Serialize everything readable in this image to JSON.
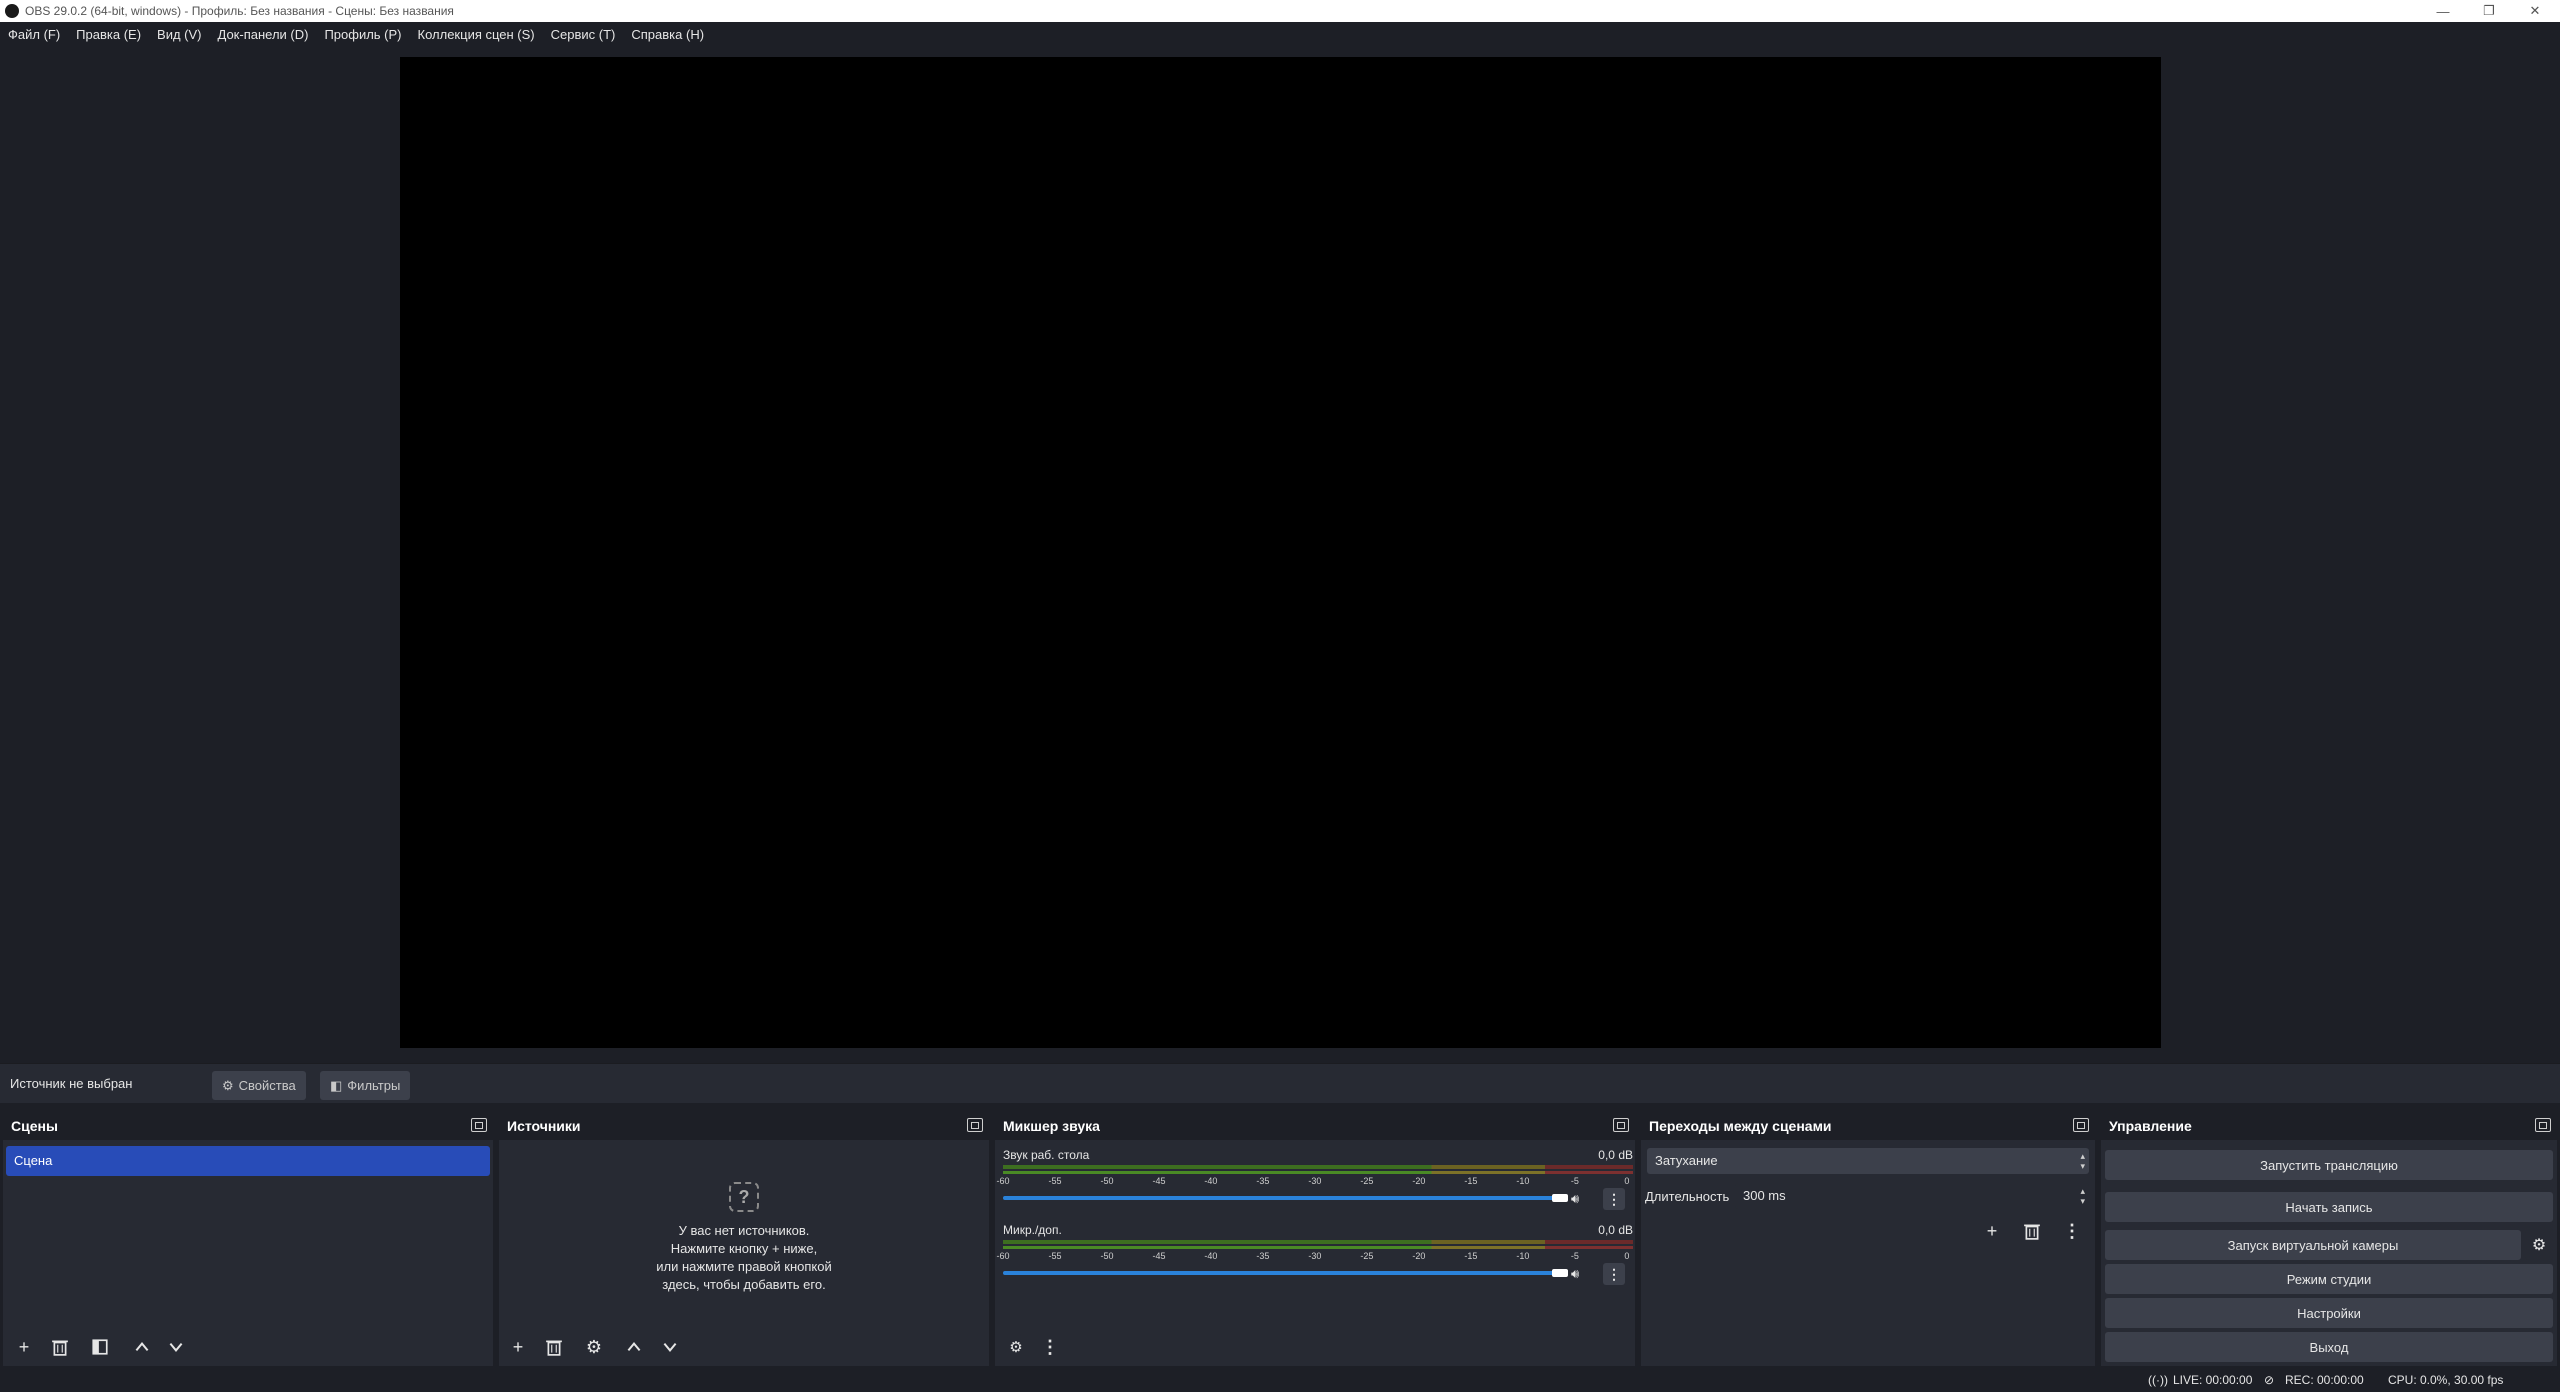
{
  "window": {
    "title": "OBS 29.0.2 (64-bit, windows) - Профиль: Без названия - Сцены: Без названия",
    "minimize": "—",
    "maximize": "❐",
    "close": "✕"
  },
  "menu": [
    "Файл (F)",
    "Правка (E)",
    "Вид (V)",
    "Док-панели (D)",
    "Профиль (P)",
    "Коллекция сцен (S)",
    "Сервис (T)",
    "Справка (H)"
  ],
  "source_toolbar": {
    "no_source": "Источник не выбран",
    "properties": "Свойства",
    "filters": "Фильтры"
  },
  "scenes": {
    "title": "Сцены",
    "items": [
      "Сцена"
    ]
  },
  "sources": {
    "title": "Источники",
    "empty_line1": "У вас нет источников.",
    "empty_line2": "Нажмите кнопку + ниже,",
    "empty_line3": "или нажмите правой кнопкой",
    "empty_line4": "здесь, чтобы добавить его."
  },
  "mixer": {
    "title": "Микшер звука",
    "ticks": [
      "-60",
      "-55",
      "-50",
      "-45",
      "-40",
      "-35",
      "-30",
      "-25",
      "-20",
      "-15",
      "-10",
      "-5",
      "0"
    ],
    "tracks": [
      {
        "name": "Звук раб. стола",
        "db": "0,0 dB",
        "volume": 1.0
      },
      {
        "name": "Микр./доп.",
        "db": "0,0 dB",
        "volume": 1.0
      }
    ]
  },
  "transitions": {
    "title": "Переходы между сценами",
    "selected": "Затухание",
    "duration_label": "Длительность",
    "duration_value": "300 ms"
  },
  "controls": {
    "title": "Управление",
    "start_stream": "Запустить трансляцию",
    "start_record": "Начать запись",
    "virtual_cam": "Запуск виртуальной камеры",
    "studio_mode": "Режим студии",
    "settings": "Настройки",
    "exit": "Выход"
  },
  "status": {
    "live": "LIVE: 00:00:00",
    "rec": "REC: 00:00:00",
    "cpu": "CPU: 0.0%, 30.00 fps"
  },
  "colors": {
    "accent": "#284cb8",
    "slider": "#2a82da",
    "panel": "#272a33",
    "background": "#1d1f26"
  }
}
